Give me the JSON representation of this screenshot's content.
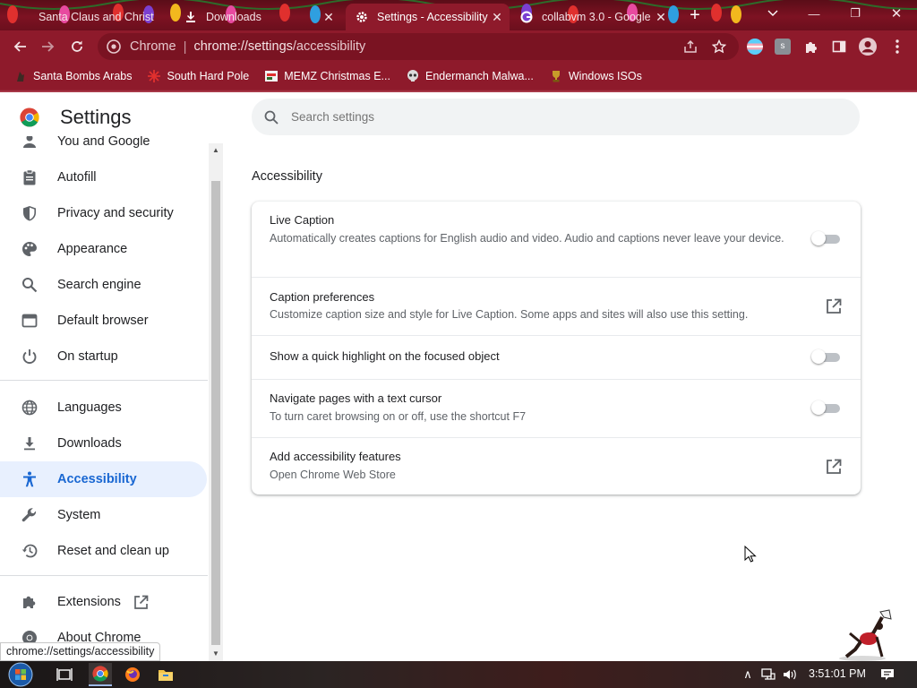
{
  "browser": {
    "tabs": [
      {
        "title": "Santa Claus and Christ",
        "icon": "christmas-bulb-icon",
        "active": false
      },
      {
        "title": "Downloads",
        "icon": "download-icon",
        "active": false
      },
      {
        "title": "Settings - Accessibility",
        "icon": "gear-icon",
        "active": true
      },
      {
        "title": "collabvm 3.0 - Google",
        "icon": "google-icon",
        "active": false
      }
    ],
    "close_glyph": "✕",
    "new_tab_glyph": "+",
    "window_controls": {
      "minimize": "—",
      "restore": "❐",
      "close": "✕"
    },
    "toolbar": {
      "site_name": "Chrome",
      "url_host": "chrome://settings",
      "url_path": "/accessibility"
    },
    "bookmarks": [
      {
        "label": "Santa Bombs Arabs",
        "icon": "santa-icon"
      },
      {
        "label": "South Hard Pole",
        "icon": "snowflake-icon"
      },
      {
        "label": "MEMZ Christmas E...",
        "icon": "memz-icon"
      },
      {
        "label": "Endermanch Malwa...",
        "icon": "skull-icon"
      },
      {
        "label": "Windows ISOs",
        "icon": "trophy-icon"
      }
    ],
    "colors": {
      "frame": "#8e1a2b",
      "tabstrip": "#6b0f1d",
      "accent": "#1a73e8"
    }
  },
  "settings": {
    "title": "Settings",
    "search_placeholder": "Search settings",
    "nav": [
      {
        "label": "You and Google",
        "icon": "person-icon"
      },
      {
        "label": "Autofill",
        "icon": "clipboard-icon"
      },
      {
        "label": "Privacy and security",
        "icon": "shield-icon"
      },
      {
        "label": "Appearance",
        "icon": "palette-icon"
      },
      {
        "label": "Search engine",
        "icon": "search-icon"
      },
      {
        "label": "Default browser",
        "icon": "browser-window-icon"
      },
      {
        "label": "On startup",
        "icon": "power-icon"
      },
      {
        "label": "Languages",
        "icon": "globe-icon"
      },
      {
        "label": "Downloads",
        "icon": "download-icon"
      },
      {
        "label": "Accessibility",
        "icon": "accessibility-icon",
        "active": true
      },
      {
        "label": "System",
        "icon": "wrench-icon"
      },
      {
        "label": "Reset and clean up",
        "icon": "history-icon"
      },
      {
        "label": "Extensions",
        "icon": "puzzle-icon"
      },
      {
        "label": "About Chrome",
        "icon": "chrome-icon"
      }
    ],
    "section_title": "Accessibility",
    "rows": [
      {
        "label": "Live Caption",
        "sub": "Automatically creates captions for English audio and video. Audio and captions never leave your device.",
        "control": "toggle",
        "enabled": false
      },
      {
        "label": "Caption preferences",
        "sub": "Customize caption size and style for Live Caption. Some apps and sites will also use this setting.",
        "control": "launch"
      },
      {
        "label": "Show a quick highlight on the focused object",
        "sub": "",
        "control": "toggle",
        "enabled": false
      },
      {
        "label": "Navigate pages with a text cursor",
        "sub": "To turn caret browsing on or off, use the shortcut F7",
        "control": "toggle",
        "enabled": false
      },
      {
        "label": "Add accessibility features",
        "sub": "Open Chrome Web Store",
        "control": "launch"
      }
    ]
  },
  "status_bar": {
    "url": "chrome://settings/accessibility"
  },
  "taskbar": {
    "apps": [
      {
        "name": "start-button"
      },
      {
        "name": "task-view-icon"
      },
      {
        "name": "chrome-taskbar-icon"
      },
      {
        "name": "firefox-taskbar-icon"
      },
      {
        "name": "file-explorer-icon"
      }
    ],
    "clock": "3:51:01 PM",
    "tray_up_glyph": "∧",
    "notification_glyph": "▤"
  }
}
